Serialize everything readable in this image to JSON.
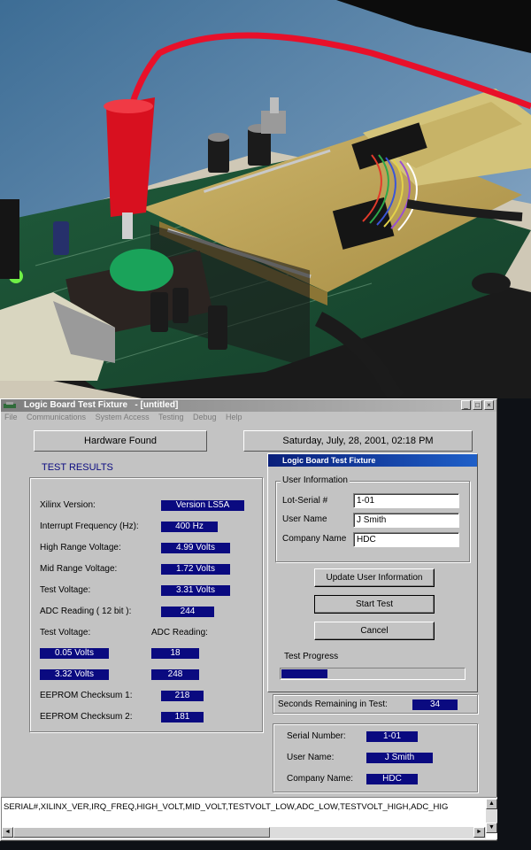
{
  "window": {
    "title": "Logic Board Test Fixture",
    "subtitle": "- [untitled]"
  },
  "menu": [
    "File",
    "Communications",
    "System Access",
    "Testing",
    "Debug",
    "Help"
  ],
  "status": {
    "hardware": "Hardware Found",
    "datetime": "Saturday, July, 28, 2001, 02:18 PM"
  },
  "results": {
    "title": "TEST RESULTS",
    "rows": [
      {
        "label": "Xilinx Version:",
        "value": "Version LS5A"
      },
      {
        "label": "Interrupt Frequency (Hz):",
        "value": "400 Hz"
      },
      {
        "label": "High Range Voltage:",
        "value": "4.99 Volts"
      },
      {
        "label": "Mid Range Voltage:",
        "value": "1.72 Volts"
      },
      {
        "label": "Test Voltage:",
        "value": "3.31 Volts"
      },
      {
        "label": "ADC Reading ( 12 bit ):",
        "value": "244"
      }
    ],
    "pair_header": {
      "left": "Test Voltage:",
      "right": "ADC Reading:"
    },
    "pairs": [
      {
        "voltage": "0.05 Volts",
        "adc": "18"
      },
      {
        "voltage": "3.32 Volts",
        "adc": "248"
      }
    ],
    "checksums": [
      {
        "label": "EEPROM Checksum 1:",
        "value": "218"
      },
      {
        "label": "EEPROM Checksum 2:",
        "value": "181"
      }
    ]
  },
  "dialog": {
    "title": "Logic Board Test Fixture",
    "group": "User Information",
    "fields": [
      {
        "label": "Lot-Serial #",
        "value": "1-01"
      },
      {
        "label": "User Name",
        "value": "J Smith"
      },
      {
        "label": "Company Name",
        "value": "HDC"
      }
    ],
    "buttons": {
      "update": "Update User Information",
      "start": "Start Test",
      "cancel": "Cancel"
    },
    "progress_label": "Test Progress",
    "progress": 0.25
  },
  "seconds": {
    "label": "Seconds Remaining in Test:",
    "value": "34"
  },
  "summary": [
    {
      "label": "Serial Number:",
      "value": "1-01"
    },
    {
      "label": "User Name:",
      "value": "J Smith"
    },
    {
      "label": "Company Name:",
      "value": "HDC"
    }
  ],
  "log_line": "SERIAL#,XILINX_VER,IRQ_FREQ,HIGH_VOLT,MID_VOLT,TESTVOLT_LOW,ADC_LOW,TESTVOLT_HIGH,ADC_HIG",
  "colors": {
    "value_bg": "#0a0a80",
    "dialog_title": "#0a1f7a",
    "window_bg": "#c3c3c3"
  }
}
